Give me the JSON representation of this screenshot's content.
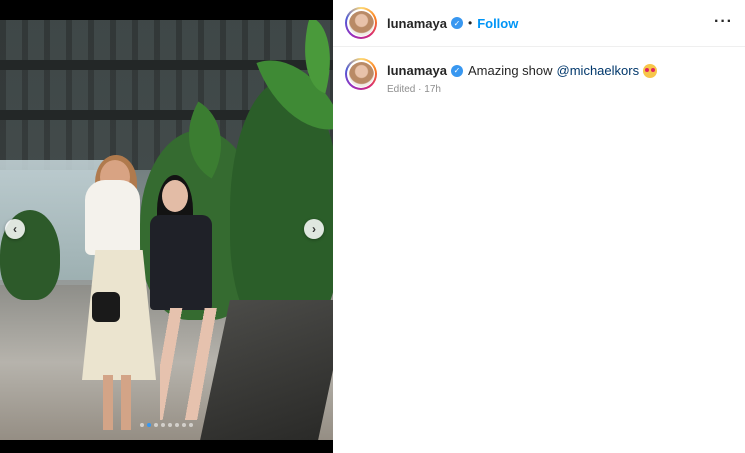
{
  "post": {
    "username": "lunamaya",
    "separator": "•",
    "follow_label": "Follow",
    "more_label": "···",
    "caption_text": "Amazing show",
    "mention": "@michaelkors",
    "edited_label": "Edited",
    "time_ago": "17h",
    "meta_separator": "·"
  },
  "carousel": {
    "prev_icon": "chevron-left-icon",
    "next_icon": "chevron-right-icon",
    "prev_glyph": "‹",
    "next_glyph": "›",
    "slide_count": 8,
    "active_slide": 2
  },
  "colors": {
    "accent": "#0095f6",
    "verified": "#3897f0",
    "mention": "#00376b"
  }
}
